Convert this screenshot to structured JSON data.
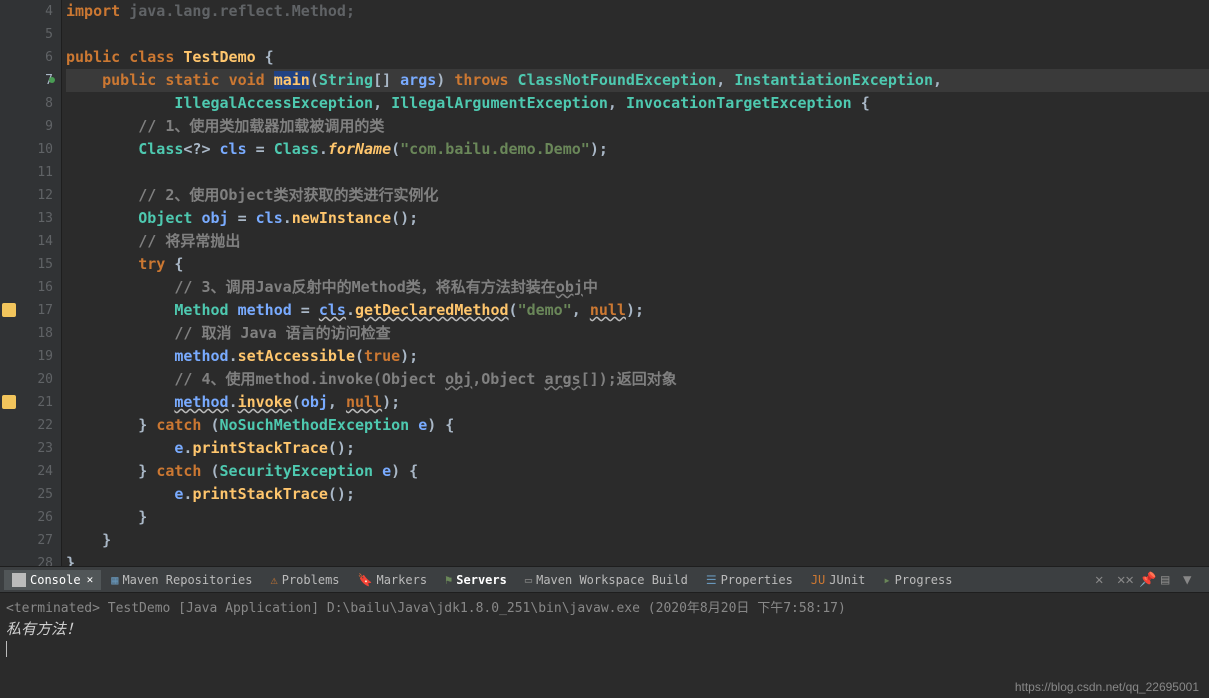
{
  "gutter": {
    "start": 4,
    "end": 28,
    "warnings": [
      17,
      21
    ],
    "highlighted": 7
  },
  "code": {
    "l4": "import java.lang.reflect.Method;",
    "l6_kw1": "public",
    "l6_kw2": "class",
    "l6_cls": "TestDemo",
    "l6_end": " {",
    "l7_kw1": "    public",
    "l7_kw2": "static",
    "l7_kw3": "void",
    "l7_mth": "main",
    "l7_p1": "(",
    "l7_cls": "String",
    "l7_arr": "[] ",
    "l7_par": "args",
    "l7_p2": ") ",
    "l7_kw4": "throws",
    "l7_e1": " ClassNotFoundException",
    "l7_c": ", ",
    "l7_e2": "InstantiationException",
    "l7_end": ",",
    "l8_pad": "            ",
    "l8_e1": "IllegalAccessException",
    "l8_c1": ", ",
    "l8_e2": "IllegalArgumentException",
    "l8_c2": ", ",
    "l8_e3": "InvocationTargetException",
    "l8_end": " {",
    "l9": "        // 1、使用类加载器加载被调用的类",
    "l10_pre": "        ",
    "l10_cls": "Class",
    "l10_gen": "<?> ",
    "l10_var": "cls",
    "l10_eq": " = ",
    "l10_cls2": "Class",
    "l10_dot": ".",
    "l10_mth": "forName",
    "l10_p1": "(",
    "l10_str": "\"com.bailu.demo.Demo\"",
    "l10_end": ");",
    "l12": "        // 2、使用Object类对获取的类进行实例化",
    "l13_pre": "        ",
    "l13_cls": "Object",
    "l13_sp": " ",
    "l13_var": "obj",
    "l13_eq": " = ",
    "l13_var2": "cls",
    "l13_dot": ".",
    "l13_mth": "newInstance",
    "l13_end": "();",
    "l14": "        // 将异常抛出",
    "l15_pre": "        ",
    "l15_kw": "try",
    "l15_end": " {",
    "l16": "            // 3、调用Java反射中的Method类，将私有方法封装在obj中",
    "l16_a": "            // 3、调用Java反射中的Method类，将私有方法封装在",
    "l16_obj": "obj",
    "l16_b": "中",
    "l17_pre": "            ",
    "l17_cls": "Method",
    "l17_sp": " ",
    "l17_var": "method",
    "l17_eq": " = ",
    "l17_var2": "cls",
    "l17_dot": ".",
    "l17_mth": "getDeclaredMethod",
    "l17_p1": "(",
    "l17_str": "\"demo\"",
    "l17_c": ", ",
    "l17_null": "null",
    "l17_end": ");",
    "l18": "            // 取消 Java 语言的访问检查",
    "l19_pre": "            ",
    "l19_var": "method",
    "l19_dot": ".",
    "l19_mth": "setAccessible",
    "l19_p1": "(",
    "l19_kw": "true",
    "l19_end": ");",
    "l20_a": "            // 4、使用method.invoke(Object ",
    "l20_obj": "obj",
    "l20_b": ",Object ",
    "l20_args": "args",
    "l20_c": "[]);返回对象",
    "l21_pre": "            ",
    "l21_var": "method",
    "l21_dot": ".",
    "l21_mth": "invoke",
    "l21_p1": "(",
    "l21_var2": "obj",
    "l21_c": ", ",
    "l21_null": "null",
    "l21_end": ");",
    "l22_pre": "        } ",
    "l22_kw": "catch",
    "l22_p1": " (",
    "l22_cls": "NoSuchMethodException",
    "l22_sp": " ",
    "l22_var": "e",
    "l22_end": ") {",
    "l23_pre": "            ",
    "l23_var": "e",
    "l23_dot": ".",
    "l23_mth": "printStackTrace",
    "l23_end": "();",
    "l24_pre": "        } ",
    "l24_kw": "catch",
    "l24_p1": " (",
    "l24_cls": "SecurityException",
    "l24_sp": " ",
    "l24_var": "e",
    "l24_end": ") {",
    "l25_pre": "            ",
    "l25_var": "e",
    "l25_dot": ".",
    "l25_mth": "printStackTrace",
    "l25_end": "();",
    "l26": "        }",
    "l27": "    }",
    "l28": "}"
  },
  "tabs": [
    {
      "label": "Console",
      "active": true,
      "closable": true
    },
    {
      "label": "Maven Repositories"
    },
    {
      "label": "Problems"
    },
    {
      "label": "Markers"
    },
    {
      "label": "Servers",
      "bold": true
    },
    {
      "label": "Maven Workspace Build"
    },
    {
      "label": "Properties"
    },
    {
      "label": "JUnit"
    },
    {
      "label": "Progress"
    }
  ],
  "console": {
    "status": "<terminated> TestDemo [Java Application] D:\\bailu\\Java\\jdk1.8.0_251\\bin\\javaw.exe (2020年8月20日 下午7:58:17)",
    "output": "私有方法！"
  },
  "watermark": "https://blog.csdn.net/qq_22695001"
}
